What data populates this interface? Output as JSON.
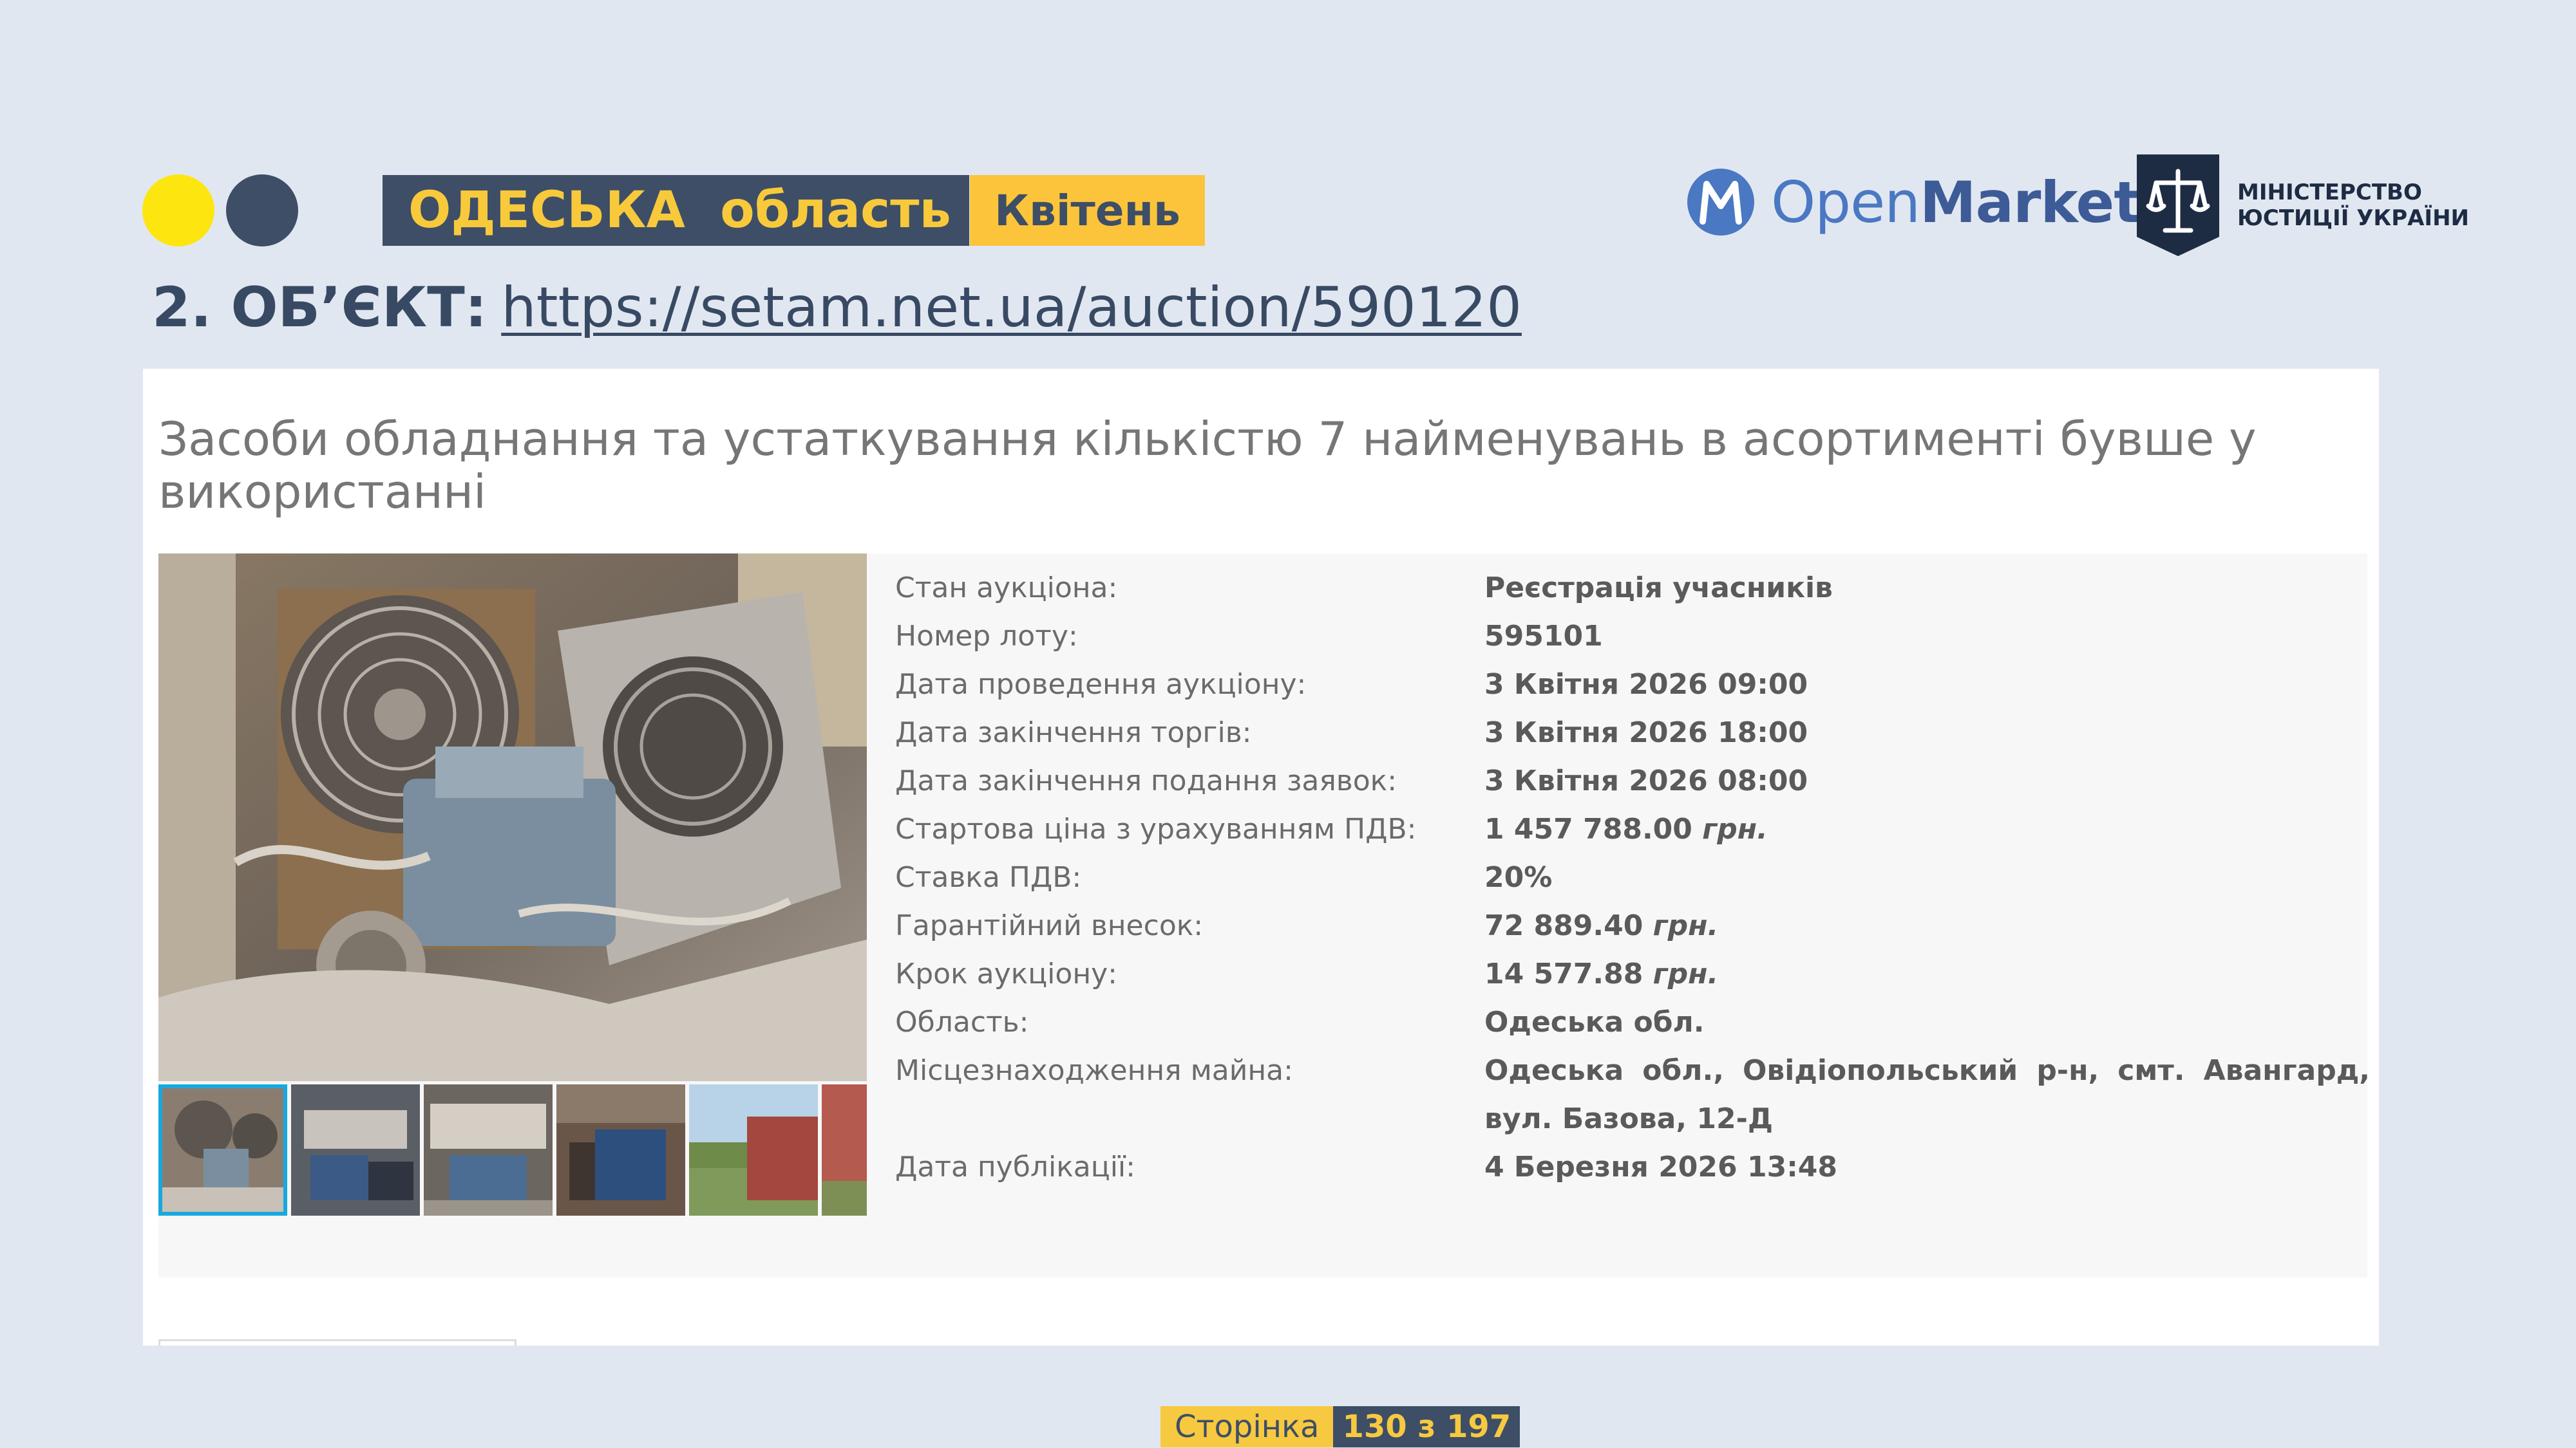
{
  "header": {
    "region": "ОДЕСЬКА  область",
    "month": "Квітень",
    "openmarket_logo": {
      "light": "Open",
      "bold": "Market"
    },
    "ministry_logo": {
      "line1": "МІНІСТЕРСТВО",
      "line2": "ЮСТИЦІЇ УКРАЇНИ"
    }
  },
  "object": {
    "label": "2. ОБ’ЄКТ:",
    "url": "https://setam.net.ua/auction/590120"
  },
  "lot": {
    "title": "Засоби обладнання та устаткування кількістю 7 найменувань в асортименті бувше у використанні",
    "details": [
      {
        "key": "Стан аукціона:",
        "value": "Реєстрація учасників"
      },
      {
        "key": "Номер лоту:",
        "value": "595101"
      },
      {
        "key": "Дата проведення аукціону:",
        "value": "3 Квітня 2026 09:00"
      },
      {
        "key": "Дата закінчення торгів:",
        "value": "3 Квітня 2026 18:00"
      },
      {
        "key": "Дата закінчення подання заявок:",
        "value": "3 Квітня 2026 08:00"
      },
      {
        "key": "Стартова ціна з урахуванням ПДВ:",
        "value": "1 457 788.00",
        "unit": "грн."
      },
      {
        "key": "Ставка ПДВ:",
        "value": "20%"
      },
      {
        "key": "Гарантійний внесок:",
        "value": "72 889.40",
        "unit": "грн."
      },
      {
        "key": "Крок аукціону:",
        "value": "14 577.88",
        "unit": "грн."
      },
      {
        "key": "Область:",
        "value": "Одеська обл."
      },
      {
        "key": "Місцезнаходження майна:",
        "value": "Одеська обл., Овідіопольський р-н, смт. Авангард, вул. Базова, 12-Д"
      },
      {
        "key": "Дата публікації:",
        "value": "4 Березня 2026 13:48"
      }
    ]
  },
  "pager": {
    "label": "Сторінка",
    "value": "130 з 197"
  },
  "colors": {
    "navy": "#3d4e66",
    "yellow": "#fcc43a",
    "accent_blue": "#18a8de",
    "background": "#e1e7f1"
  }
}
